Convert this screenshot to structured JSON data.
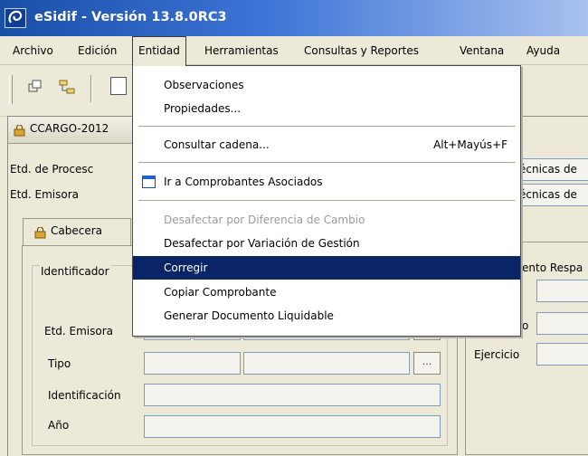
{
  "window": {
    "title": "eSidif - Versión 13.8.0RC3"
  },
  "menubar": {
    "items": [
      "Archivo",
      "Edición",
      "Entidad",
      "Herramientas",
      "Consultas y Reportes",
      "Ventana",
      "Ayuda"
    ],
    "active": "Entidad"
  },
  "entidad_menu": {
    "items": [
      {
        "label": "Observaciones",
        "enabled": true
      },
      {
        "label": "Propiedades...",
        "enabled": true
      },
      {
        "label": "Consultar cadena...",
        "shortcut": "Alt+Mayús+F",
        "enabled": true
      },
      {
        "label": "Ir a Comprobantes Asociados",
        "icon": "window-icon",
        "enabled": true
      },
      {
        "label": "Desafectar por Diferencia de Cambio",
        "enabled": false
      },
      {
        "label": "Desafectar por Variación de Gestión",
        "enabled": true
      },
      {
        "label": "Corregir",
        "enabled": true,
        "highlighted": true
      },
      {
        "label": "Copiar Comprobante",
        "enabled": true
      },
      {
        "label": "Generar Documento Liquidable",
        "enabled": true
      }
    ]
  },
  "document": {
    "tab_title": "CCARGO-2012",
    "fields": {
      "etd_proceso_label": "Etd. de Procesc",
      "etd_emisora_label": "Etd. Emisora",
      "etd_proceso_value": "écnicas de",
      "etd_emisora_value": "écnicas de"
    },
    "tabs": {
      "cabecera": "Cabecera"
    },
    "identificador": {
      "group_label": "Identificador",
      "etd_emisora": "Etd. Emisora",
      "tipo": "Tipo",
      "identificacion": "Identificación",
      "anio": "Año",
      "browse_button": "..."
    },
    "right": {
      "group_label": "ento Respa",
      "partial_label": "o",
      "ejercicio": "Ejercicio"
    }
  }
}
